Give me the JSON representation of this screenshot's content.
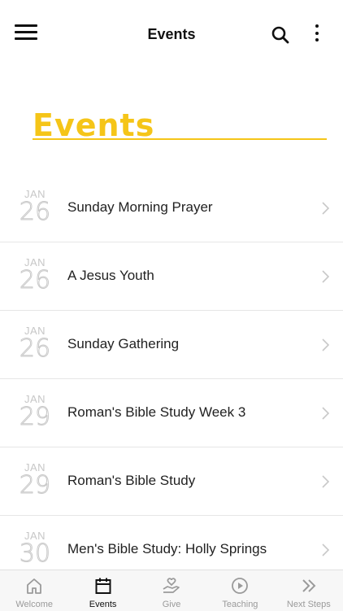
{
  "header": {
    "title": "Events"
  },
  "heading": "Events",
  "events": [
    {
      "month": "JAN",
      "day": "26",
      "name": "Sunday Morning Prayer"
    },
    {
      "month": "JAN",
      "day": "26",
      "name": "A Jesus Youth"
    },
    {
      "month": "JAN",
      "day": "26",
      "name": "Sunday Gathering"
    },
    {
      "month": "JAN",
      "day": "29",
      "name": "Roman's Bible Study Week 3"
    },
    {
      "month": "JAN",
      "day": "29",
      "name": "Roman's Bible Study"
    },
    {
      "month": "JAN",
      "day": "30",
      "name": "Men's Bible Study: Holly Springs"
    }
  ],
  "tabs": [
    {
      "label": "Welcome",
      "icon": "home-icon"
    },
    {
      "label": "Events",
      "icon": "calendar-icon",
      "active": true
    },
    {
      "label": "Give",
      "icon": "give-hand-heart-icon"
    },
    {
      "label": "Teaching",
      "icon": "play-circle-icon"
    },
    {
      "label": "Next Steps",
      "icon": "double-chevron-right-icon"
    }
  ],
  "colors": {
    "accent": "#f5c518",
    "text": "#222222",
    "muted": "#c7c7c7"
  }
}
